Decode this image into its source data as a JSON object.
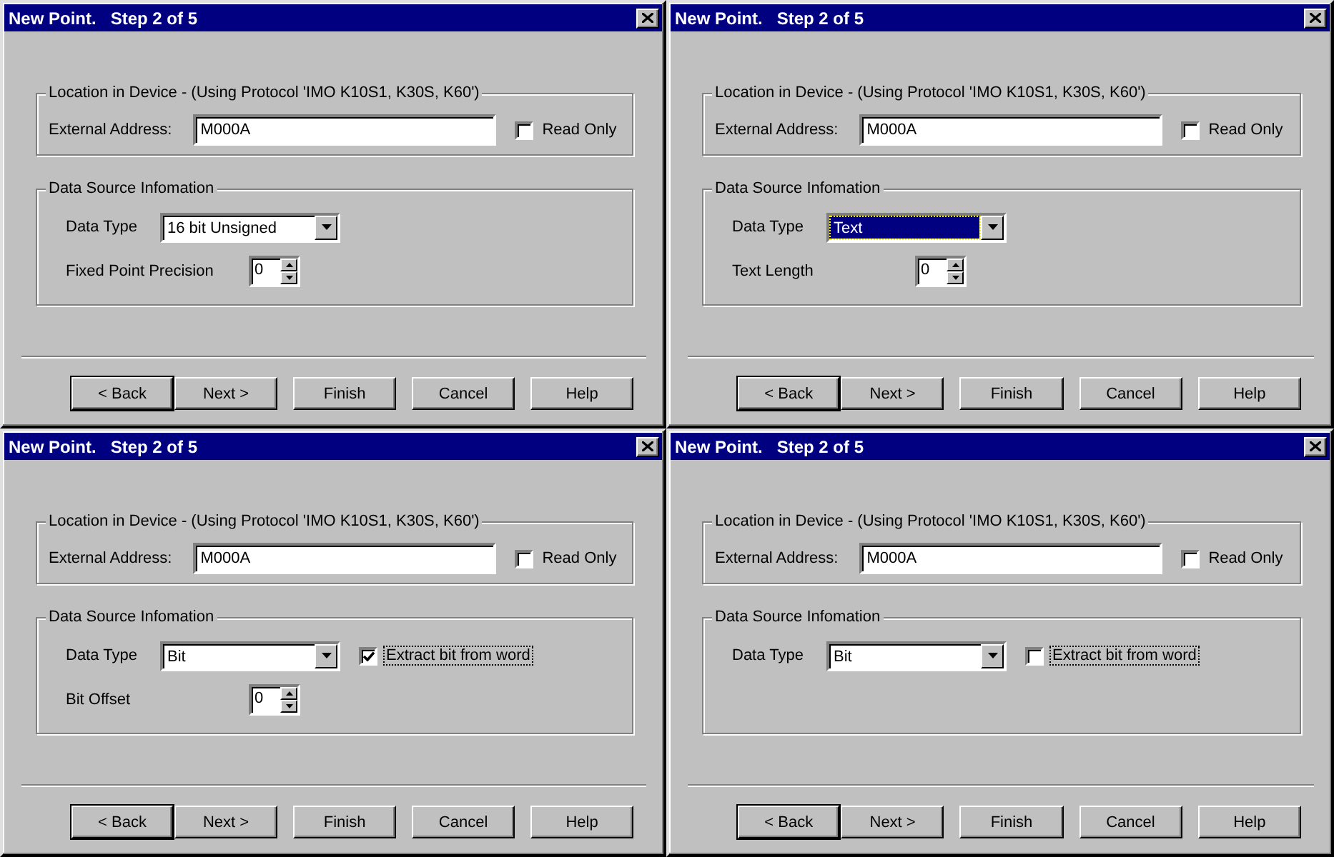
{
  "dialogs": [
    {
      "title": "New Point.   Step 2 of 5",
      "location": {
        "legend": "Location in Device - (Using Protocol 'IMO K10S1, K30S, K60')",
        "address_label": "External Address:",
        "address": "M000A",
        "read_only": {
          "label": "Read Only",
          "checked": false
        }
      },
      "source": {
        "legend": "Data Source Infomation",
        "rows": [
          {
            "kind": "select",
            "label": "Data Type",
            "value": "16 bit Unsigned",
            "highlighted": false
          },
          {
            "kind": "spinner",
            "label": "Fixed Point Precision",
            "value": "0"
          }
        ]
      },
      "buttons": [
        {
          "label": "< Back",
          "default": true
        },
        {
          "label": "Next >",
          "default": false
        },
        {
          "label": "Finish",
          "default": false
        },
        {
          "label": "Cancel",
          "default": false
        },
        {
          "label": "Help",
          "default": false
        }
      ]
    },
    {
      "title": "New Point.   Step 2 of 5",
      "location": {
        "legend": "Location in Device - (Using Protocol 'IMO K10S1, K30S, K60')",
        "address_label": "External Address:",
        "address": "M000A",
        "read_only": {
          "label": "Read Only",
          "checked": false
        }
      },
      "source": {
        "legend": "Data Source Infomation",
        "rows": [
          {
            "kind": "select",
            "label": "Data Type",
            "value": "Text",
            "highlighted": true
          },
          {
            "kind": "spinner",
            "label": "Text Length",
            "value": "0"
          }
        ]
      },
      "buttons": [
        {
          "label": "< Back",
          "default": true
        },
        {
          "label": "Next >",
          "default": false
        },
        {
          "label": "Finish",
          "default": false
        },
        {
          "label": "Cancel",
          "default": false
        },
        {
          "label": "Help",
          "default": false
        }
      ]
    },
    {
      "title": "New Point.   Step 2 of 5",
      "location": {
        "legend": "Location in Device - (Using Protocol 'IMO K10S1, K30S, K60')",
        "address_label": "External Address:",
        "address": "M000A",
        "read_only": {
          "label": "Read Only",
          "checked": false
        }
      },
      "source": {
        "legend": "Data Source Infomation",
        "rows": [
          {
            "kind": "select",
            "label": "Data Type",
            "value": "Bit",
            "highlighted": false,
            "checkbox": {
              "label": "Extract bit from word",
              "checked": true,
              "focused": true
            }
          },
          {
            "kind": "spinner",
            "label": "Bit Offset",
            "value": "0"
          }
        ]
      },
      "buttons": [
        {
          "label": "< Back",
          "default": true
        },
        {
          "label": "Next >",
          "default": false
        },
        {
          "label": "Finish",
          "default": false
        },
        {
          "label": "Cancel",
          "default": false
        },
        {
          "label": "Help",
          "default": false
        }
      ]
    },
    {
      "title": "New Point.   Step 2 of 5",
      "location": {
        "legend": "Location in Device - (Using Protocol 'IMO K10S1, K30S, K60')",
        "address_label": "External Address:",
        "address": "M000A",
        "read_only": {
          "label": "Read Only",
          "checked": false
        }
      },
      "source": {
        "legend": "Data Source Infomation",
        "rows": [
          {
            "kind": "select",
            "label": "Data Type",
            "value": "Bit",
            "highlighted": false,
            "checkbox": {
              "label": "Extract bit from word",
              "checked": false,
              "focused": true
            }
          }
        ]
      },
      "buttons": [
        {
          "label": "< Back",
          "default": true
        },
        {
          "label": "Next >",
          "default": false
        },
        {
          "label": "Finish",
          "default": false
        },
        {
          "label": "Cancel",
          "default": false
        },
        {
          "label": "Help",
          "default": false
        }
      ]
    }
  ]
}
